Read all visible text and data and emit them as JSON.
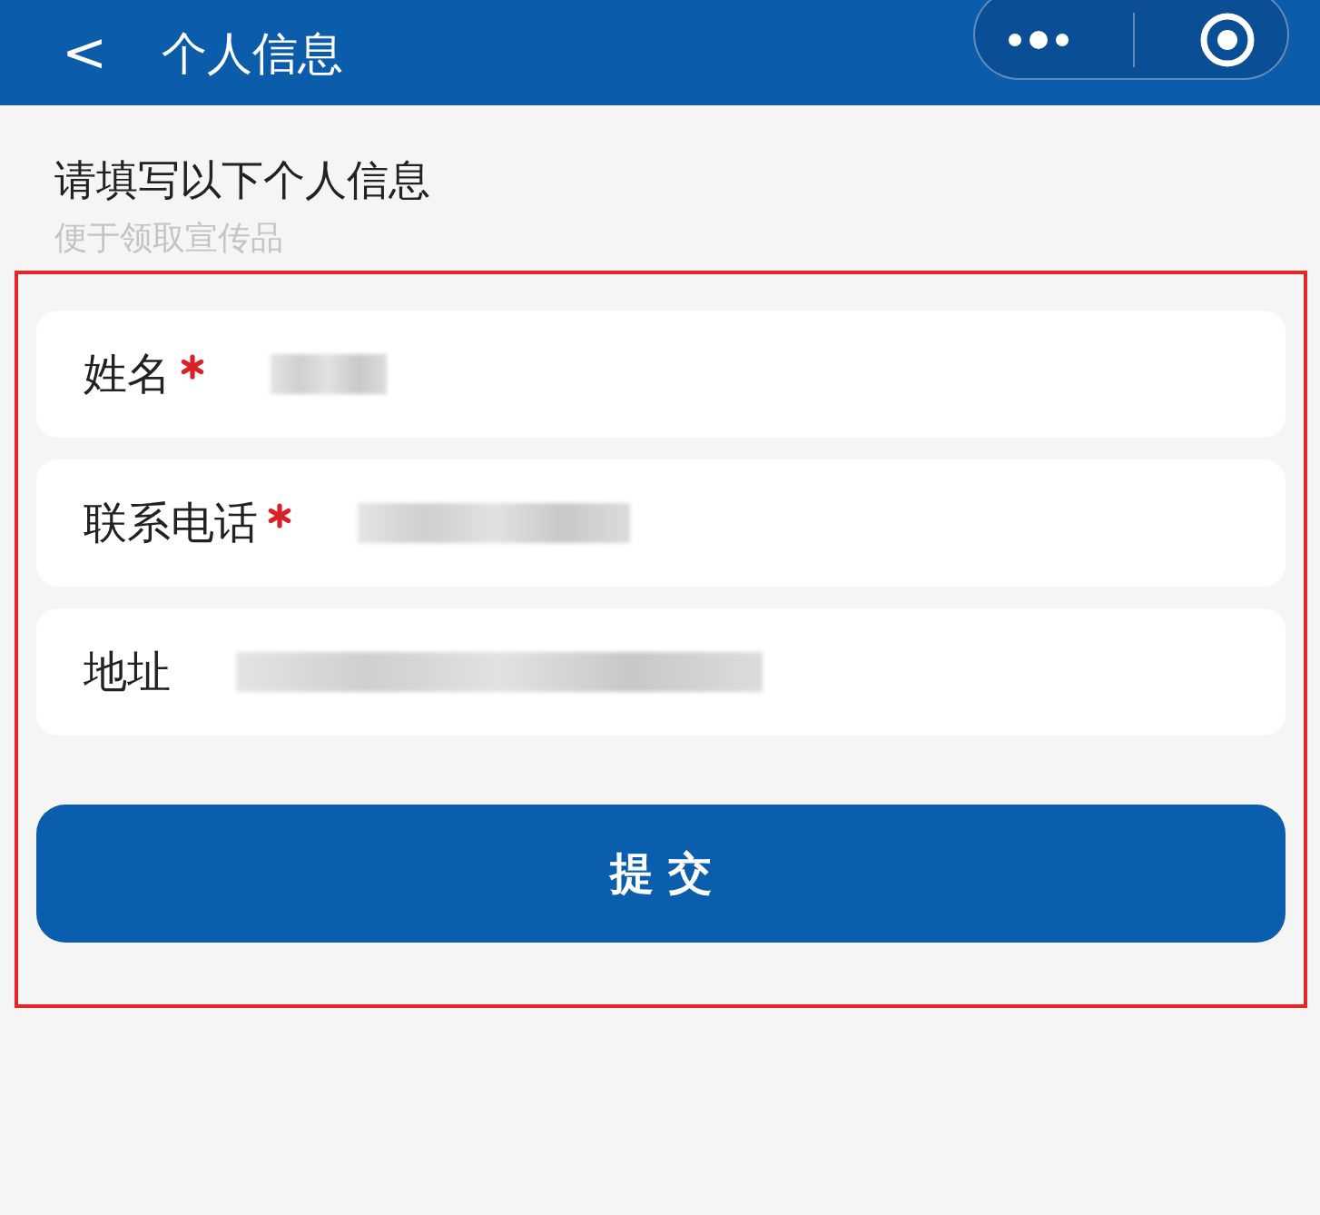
{
  "nav_bar": {
    "back": "<",
    "title": "个人信息"
  },
  "intro": {
    "heading": "请填写以下个人信息",
    "subheading": "便于领取宣传品"
  },
  "form": {
    "highlighted": true,
    "fields": [
      {
        "label": "姓名",
        "required": true,
        "redacted": true
      },
      {
        "label": "联系电话",
        "required": true,
        "redacted": true
      },
      {
        "label": "地址",
        "required": false,
        "redacted": true
      }
    ],
    "submit": "提 交"
  }
}
